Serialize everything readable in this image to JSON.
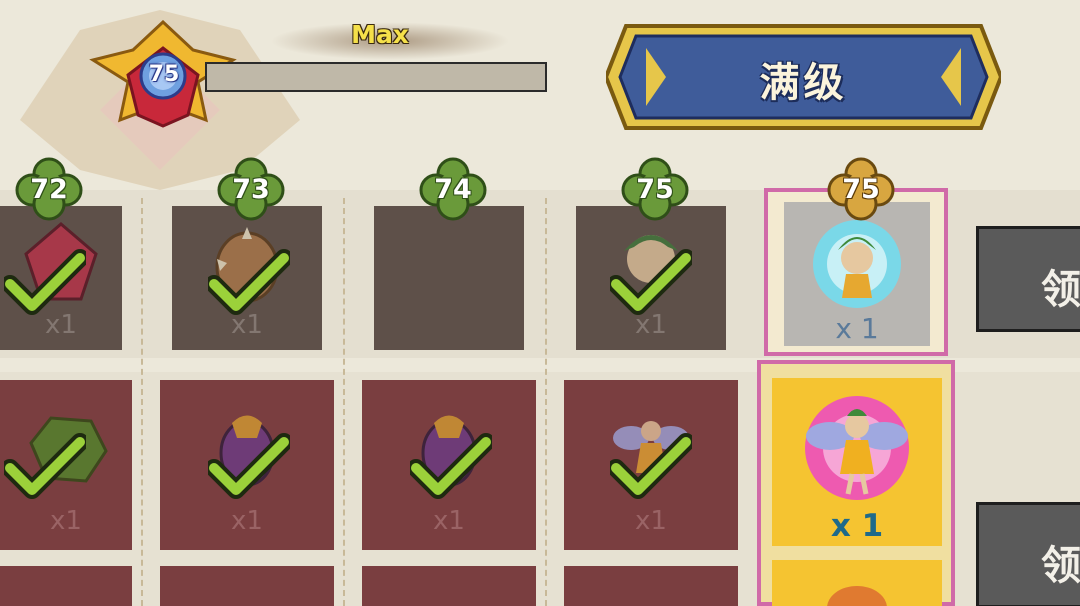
{
  "player": {
    "level": "75"
  },
  "exp_bar": {
    "label": "Max",
    "fill": 0
  },
  "title_banner": {
    "label": "满级"
  },
  "free_track": {
    "levels": [
      "72",
      "73",
      "74",
      "75",
      "75"
    ],
    "items": [
      {
        "icon": "ruby-gem-icon",
        "quantity": "x1",
        "claimed": true
      },
      {
        "icon": "spiked-egg-icon",
        "quantity": "x1",
        "claimed": true
      },
      {
        "icon": "",
        "quantity": "",
        "claimed": false
      },
      {
        "icon": "fairy-head-icon",
        "quantity": "x1",
        "claimed": true
      },
      {
        "icon": "fairy-portrait-icon",
        "quantity": "x 1",
        "claimed": false
      }
    ]
  },
  "premium_track": {
    "items": [
      {
        "icon": "green-ore-icon",
        "quantity": "x1",
        "claimed": true
      },
      {
        "icon": "purple-egg-icon",
        "quantity": "x1",
        "claimed": true
      },
      {
        "icon": "purple-egg-icon",
        "quantity": "x1",
        "claimed": true
      },
      {
        "icon": "fairy-figure-icon",
        "quantity": "x1",
        "claimed": true
      },
      {
        "icon": "fairy-figure-icon",
        "quantity": "x 1",
        "claimed": false
      }
    ]
  },
  "claim_button": {
    "label": "领"
  },
  "colors": {
    "accent_pink": "#d06aa8",
    "gold": "#f5c431",
    "check_green": "#9bd13a",
    "clover_green": "#6a9a3a"
  }
}
